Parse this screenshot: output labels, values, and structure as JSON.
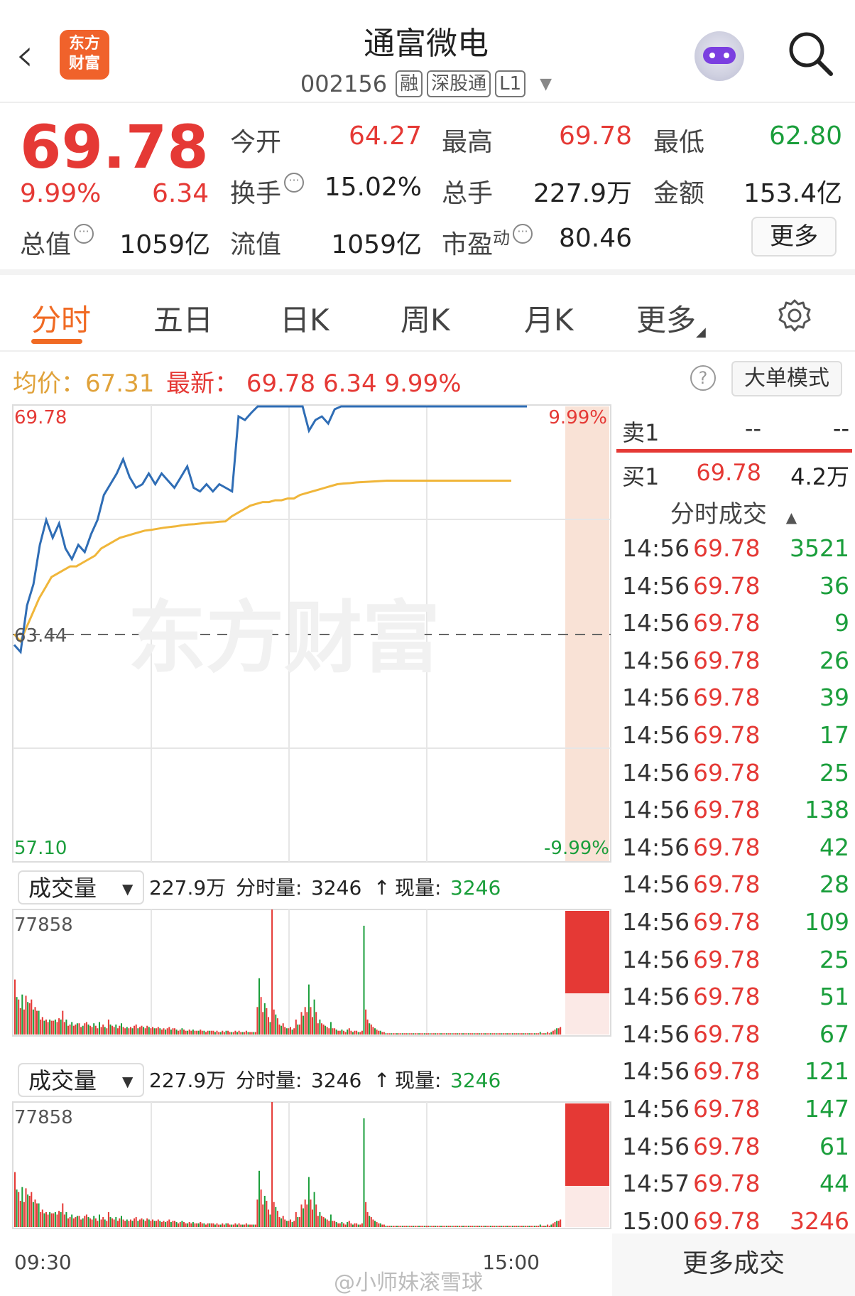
{
  "header": {
    "back_icon": "chevron-left-icon",
    "logo_text_1": "东方",
    "logo_text_2": "财富",
    "stock_name": "通富微电",
    "stock_code": "002156",
    "tags": [
      "融",
      "深股通",
      "L1"
    ],
    "avatar_icon": "robot-avatar-icon",
    "search_icon": "search-icon"
  },
  "quote": {
    "price": "69.78",
    "change_pct": "9.99%",
    "change": "6.34",
    "open_label": "今开",
    "open": "64.27",
    "high_label": "最高",
    "high": "69.78",
    "low_label": "最低",
    "low": "62.80",
    "turnover_label": "换手",
    "turnover": "15.02%",
    "volume_label": "总手",
    "volume": "227.9万",
    "amount_label": "金额",
    "amount": "153.4亿",
    "mcap_label": "总值",
    "mcap": "1059亿",
    "float_label": "流值",
    "float": "1059亿",
    "pe_label": "市盈",
    "pe_sup": "动",
    "pe": "80.46",
    "more_label": "更多",
    "colors": {
      "up": "#e53935",
      "down": "#1a9e3b"
    }
  },
  "tabs": [
    {
      "label": "分时",
      "active": true
    },
    {
      "label": "五日"
    },
    {
      "label": "日K"
    },
    {
      "label": "周K"
    },
    {
      "label": "月K"
    },
    {
      "label": "更多"
    }
  ],
  "info_row": {
    "avg_label": "均价：67.31",
    "latest_label": "最新：",
    "latest_price": "69.78",
    "latest_change": "6.34",
    "latest_pct": "9.99%",
    "help_icon": "question-icon",
    "big_order_label": "大单模式"
  },
  "chart_data": {
    "type": "line",
    "y_top_label": "69.78",
    "y_top_pct": "9.99%",
    "y_mid_label": "63.44",
    "y_bottom_label": "57.10",
    "y_bottom_pct": "-9.99%",
    "ylim": [
      57.1,
      69.78
    ],
    "prev_close": 63.44,
    "x_start": "09:30",
    "x_end": "15:00",
    "watermark": "东方财富",
    "series": [
      {
        "values": [
          63.1,
          62.9,
          64.2,
          64.8,
          65.9,
          66.6,
          66.1,
          66.5,
          65.8,
          65.5,
          65.9,
          65.7,
          66.2,
          66.6,
          67.3,
          67.6,
          67.9,
          68.3,
          67.8,
          67.5,
          67.6,
          67.9,
          67.6,
          67.9,
          67.7,
          67.5,
          67.8,
          68.1,
          67.5,
          67.4,
          67.6,
          67.4,
          67.6,
          67.5,
          67.4,
          69.5,
          69.4,
          69.6,
          69.78,
          69.78,
          69.78,
          69.78,
          69.78,
          69.78,
          69.78,
          69.78,
          69.1,
          69.4,
          69.5,
          69.3,
          69.7,
          69.78,
          69.78,
          69.78,
          69.78,
          69.78,
          69.78,
          69.78,
          69.78,
          69.78,
          69.78,
          69.78,
          69.78,
          69.78,
          69.78,
          69.78,
          69.78,
          69.78,
          69.78,
          69.78,
          69.78,
          69.78,
          69.78,
          69.78,
          69.78,
          69.78,
          69.78,
          69.78,
          69.78,
          69.78,
          69.78
        ],
        "color": "#2f6db5"
      },
      {
        "values": [
          63.4,
          63.2,
          63.6,
          64.0,
          64.4,
          64.7,
          65.0,
          65.1,
          65.2,
          65.3,
          65.3,
          65.4,
          65.5,
          65.6,
          65.8,
          65.9,
          66.0,
          66.1,
          66.15,
          66.2,
          66.25,
          66.3,
          66.32,
          66.35,
          66.38,
          66.4,
          66.42,
          66.45,
          66.47,
          66.48,
          66.5,
          66.52,
          66.53,
          66.55,
          66.56,
          66.7,
          66.8,
          66.9,
          67.0,
          67.05,
          67.1,
          67.1,
          67.15,
          67.15,
          67.2,
          67.2,
          67.3,
          67.35,
          67.4,
          67.45,
          67.5,
          67.55,
          67.6,
          67.62,
          67.63,
          67.65,
          67.66,
          67.67,
          67.68,
          67.69,
          67.7,
          67.7,
          67.7,
          67.7,
          67.7,
          67.7,
          67.7,
          67.7,
          67.7,
          67.7,
          67.7,
          67.7,
          67.7,
          67.7,
          67.7,
          67.7,
          67.7,
          67.7,
          67.7,
          67.7,
          67.7
        ],
        "color": "#f0b63a"
      }
    ]
  },
  "volume_panels": [
    {
      "selector_label": "成交量",
      "total": "227.9万",
      "period_label": "分时量:",
      "period_value": "3246",
      "current_label": "现量:",
      "current_value": "3246",
      "y_max_label": "77858"
    },
    {
      "selector_label": "成交量",
      "total": "227.9万",
      "period_label": "分时量:",
      "period_value": "3246",
      "current_label": "现量:",
      "current_value": "3246",
      "y_max_label": "77858"
    }
  ],
  "volume_data": [
    44,
    30,
    28,
    21,
    32,
    20,
    31,
    26,
    25,
    28,
    20,
    22,
    19,
    19,
    12,
    14,
    11,
    12,
    10,
    12,
    11,
    11,
    12,
    10,
    13,
    12,
    19,
    10,
    12,
    7,
    8,
    10,
    7,
    8,
    9,
    9,
    6,
    7,
    9,
    10,
    8,
    7,
    6,
    9,
    7,
    5,
    10,
    6,
    8,
    6,
    5,
    12,
    8,
    7,
    6,
    8,
    5,
    7,
    9,
    6,
    5,
    6,
    5,
    6,
    5,
    7,
    8,
    5,
    6,
    7,
    6,
    5,
    7,
    6,
    5,
    6,
    5,
    5,
    6,
    5,
    4,
    5,
    4,
    5,
    6,
    4,
    5,
    5,
    4,
    3,
    4,
    5,
    4,
    3,
    3,
    4,
    3,
    4,
    3,
    3,
    3,
    4,
    3,
    3,
    2,
    3,
    3,
    3,
    3,
    2,
    3,
    2,
    2,
    3,
    2,
    3,
    3,
    2,
    2,
    2,
    3,
    2,
    3,
    2,
    2,
    2,
    3,
    2,
    2,
    2,
    2,
    2,
    22,
    45,
    30,
    18,
    25,
    21,
    14,
    10,
    100,
    20,
    16,
    13,
    8,
    7,
    9,
    6,
    5,
    5,
    6,
    4,
    5,
    12,
    8,
    8,
    18,
    15,
    22,
    18,
    40,
    22,
    14,
    28,
    18,
    9,
    12,
    9,
    8,
    7,
    6,
    5,
    10,
    5,
    5,
    4,
    3,
    3,
    4,
    3,
    2,
    4,
    5,
    3,
    2,
    3,
    3,
    2,
    2,
    3,
    87,
    20,
    12,
    9,
    8,
    6,
    5,
    4,
    3,
    3,
    2,
    2,
    1,
    1,
    1,
    1,
    1,
    1,
    1,
    1,
    1,
    1,
    1,
    1,
    1,
    1,
    1,
    1,
    1,
    1,
    1,
    1,
    1,
    1,
    1,
    1,
    1,
    1,
    1,
    1,
    1,
    1,
    1,
    1,
    1,
    1,
    1,
    1,
    1,
    1,
    1,
    1,
    1,
    1,
    1,
    1,
    1,
    1,
    1,
    1,
    1,
    1,
    1,
    1,
    1,
    1,
    1,
    1,
    1,
    1,
    1,
    1,
    1,
    1,
    1,
    1,
    1,
    1,
    1,
    1,
    1,
    1,
    1,
    1,
    1,
    1,
    1,
    1,
    1,
    1,
    1,
    1,
    1,
    1,
    1,
    1,
    2,
    1,
    1,
    1,
    2,
    1,
    2,
    3,
    4,
    5,
    5,
    6
  ],
  "order_book": {
    "sell_label": "卖1",
    "sell_price": "--",
    "sell_vol": "--",
    "buy_label": "买1",
    "buy_price": "69.78",
    "buy_vol": "4.2万"
  },
  "ticks_header": "分时成交",
  "ticks": [
    {
      "time": "14:56",
      "price": "69.78",
      "vol": "3521"
    },
    {
      "time": "14:56",
      "price": "69.78",
      "vol": "36"
    },
    {
      "time": "14:56",
      "price": "69.78",
      "vol": "9"
    },
    {
      "time": "14:56",
      "price": "69.78",
      "vol": "26"
    },
    {
      "time": "14:56",
      "price": "69.78",
      "vol": "39"
    },
    {
      "time": "14:56",
      "price": "69.78",
      "vol": "17"
    },
    {
      "time": "14:56",
      "price": "69.78",
      "vol": "25"
    },
    {
      "time": "14:56",
      "price": "69.78",
      "vol": "138"
    },
    {
      "time": "14:56",
      "price": "69.78",
      "vol": "42"
    },
    {
      "time": "14:56",
      "price": "69.78",
      "vol": "28"
    },
    {
      "time": "14:56",
      "price": "69.78",
      "vol": "109"
    },
    {
      "time": "14:56",
      "price": "69.78",
      "vol": "25"
    },
    {
      "time": "14:56",
      "price": "69.78",
      "vol": "51"
    },
    {
      "time": "14:56",
      "price": "69.78",
      "vol": "67"
    },
    {
      "time": "14:56",
      "price": "69.78",
      "vol": "121"
    },
    {
      "time": "14:56",
      "price": "69.78",
      "vol": "147"
    },
    {
      "time": "14:56",
      "price": "69.78",
      "vol": "61"
    },
    {
      "time": "14:57",
      "price": "69.78",
      "vol": "44"
    },
    {
      "time": "15:00",
      "price": "69.78",
      "vol": "3246"
    }
  ],
  "more_ticks_label": "更多成交",
  "footer_watermark": "@小师妹滚雪球"
}
